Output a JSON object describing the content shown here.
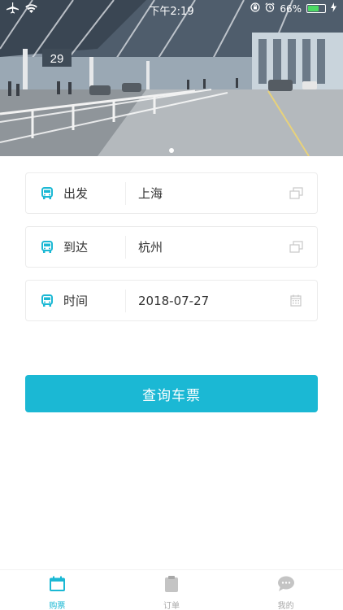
{
  "status_bar": {
    "time": "下午2:19",
    "battery": "66%",
    "battery_level": 0.66
  },
  "hero": {
    "gate_number": "29",
    "slides_total": 1,
    "active_slide": 1
  },
  "form": {
    "departure": {
      "label": "出发",
      "value": "上海",
      "icon": "bus-icon",
      "action_icon": "swap-icon"
    },
    "arrival": {
      "label": "到达",
      "value": "杭州",
      "icon": "bus-icon",
      "action_icon": "swap-icon"
    },
    "date": {
      "label": "时间",
      "value": "2018-07-27",
      "icon": "bus-icon",
      "action_icon": "calendar-icon"
    }
  },
  "submit": {
    "label": "查询车票"
  },
  "tabbar": {
    "tabs": [
      {
        "label": "购票",
        "icon": "calendar-icon",
        "active": true
      },
      {
        "label": "订单",
        "icon": "clipboard-icon",
        "active": false
      },
      {
        "label": "我的",
        "icon": "chat-bubble-icon",
        "active": false
      }
    ]
  },
  "colors": {
    "accent": "#1bb8d4",
    "inactive": "#a8a8a8",
    "border": "#ececec"
  }
}
